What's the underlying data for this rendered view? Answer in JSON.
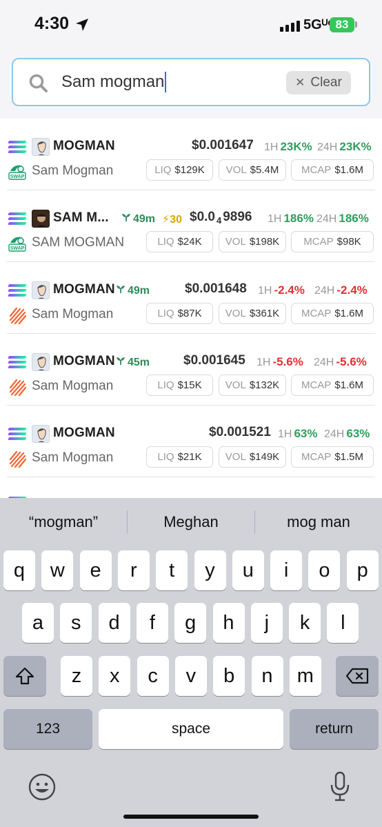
{
  "status_bar": {
    "time": "4:30",
    "network": "5Gᵁᶜ",
    "battery": "83"
  },
  "search": {
    "value": "Sam mogman",
    "clear_label": "Clear"
  },
  "results": [
    {
      "name": "MOGMAN",
      "subname": "Sam Mogman",
      "dex": "swap",
      "age": "",
      "boost": "",
      "price": "$0.001647",
      "price_sub": "",
      "price_tail": "",
      "h1_label": "1H",
      "h1": "23K%",
      "h1_dir": "up",
      "h24_label": "24H",
      "h24": "23K%",
      "h24_dir": "up",
      "liq_label": "LIQ",
      "liq": "$129K",
      "vol_label": "VOL",
      "vol": "$5.4M",
      "mcap_label": "MCAP",
      "mcap": "$1.6M"
    },
    {
      "name": "SAM M...",
      "subname": "SAM MOGMAN",
      "dex": "swap",
      "age": "49m",
      "boost": "⚡30",
      "price": "$0.0",
      "price_sub": "4",
      "price_tail": "9896",
      "h1_label": "1H",
      "h1": "186%",
      "h1_dir": "up",
      "h24_label": "24H",
      "h24": "186%",
      "h24_dir": "up",
      "liq_label": "LIQ",
      "liq": "$24K",
      "vol_label": "VOL",
      "vol": "$198K",
      "mcap_label": "MCAP",
      "mcap": "$98K"
    },
    {
      "name": "MOGMAN",
      "subname": "Sam Mogman",
      "dex": "pump",
      "age": "49m",
      "boost": "",
      "price": "$0.001648",
      "price_sub": "",
      "price_tail": "",
      "h1_label": "1H",
      "h1": "-2.4%",
      "h1_dir": "down",
      "h24_label": "24H",
      "h24": "-2.4%",
      "h24_dir": "down",
      "liq_label": "LIQ",
      "liq": "$87K",
      "vol_label": "VOL",
      "vol": "$361K",
      "mcap_label": "MCAP",
      "mcap": "$1.6M"
    },
    {
      "name": "MOGMAN",
      "subname": "Sam Mogman",
      "dex": "pump",
      "age": "45m",
      "boost": "",
      "price": "$0.001645",
      "price_sub": "",
      "price_tail": "",
      "h1_label": "1H",
      "h1": "-5.6%",
      "h1_dir": "down",
      "h24_label": "24H",
      "h24": "-5.6%",
      "h24_dir": "down",
      "liq_label": "LIQ",
      "liq": "$15K",
      "vol_label": "VOL",
      "vol": "$132K",
      "mcap_label": "MCAP",
      "mcap": "$1.6M"
    },
    {
      "name": "MOGMAN",
      "subname": "Sam Mogman",
      "dex": "pump",
      "age": "",
      "boost": "",
      "price": "$0.001521",
      "price_sub": "",
      "price_tail": "",
      "h1_label": "1H",
      "h1": "63%",
      "h1_dir": "up",
      "h24_label": "24H",
      "h24": "63%",
      "h24_dir": "up",
      "liq_label": "LIQ",
      "liq": "$21K",
      "vol_label": "VOL",
      "vol": "$149K",
      "mcap_label": "MCAP",
      "mcap": "$1.5M"
    }
  ],
  "keyboard": {
    "suggestions": [
      "“mogman”",
      "Meghan",
      "mog man"
    ],
    "row1": [
      "q",
      "w",
      "e",
      "r",
      "t",
      "y",
      "u",
      "i",
      "o",
      "p"
    ],
    "row2": [
      "a",
      "s",
      "d",
      "f",
      "g",
      "h",
      "j",
      "k",
      "l"
    ],
    "row3": [
      "z",
      "x",
      "c",
      "v",
      "b",
      "n",
      "m"
    ],
    "numbers_label": "123",
    "space_label": "space",
    "return_label": "return"
  },
  "colors": {
    "up": "#2e9e5b",
    "down": "#e03131",
    "age": "#2e8b57",
    "boost": "#d4a800",
    "search_border": "#8cc8e6",
    "battery": "#34c759"
  },
  "icons": {
    "chain": "solana-icon",
    "dex_swap": "swap-icon",
    "dex_pump": "pump-icon",
    "search": "search-icon",
    "clear": "close-icon",
    "shift": "shift-icon",
    "delete": "backspace-icon",
    "emoji": "emoji-icon",
    "mic": "microphone-icon",
    "location": "location-arrow-icon",
    "age": "sprout-icon"
  }
}
